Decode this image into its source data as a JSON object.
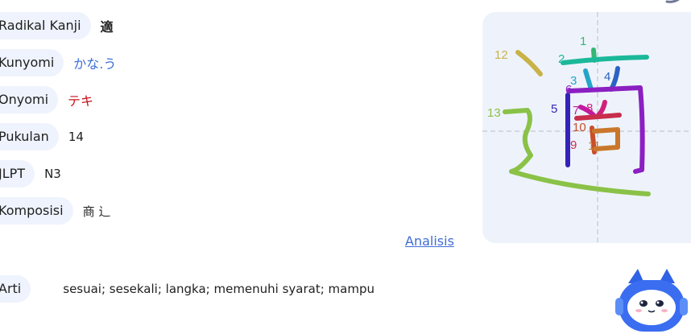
{
  "info_rows": [
    {
      "label": "Radikal Kanji",
      "value": "適",
      "style": "kanji"
    },
    {
      "label": "Kunyomi",
      "value": "かな.う",
      "style": "blue"
    },
    {
      "label": "Onyomi",
      "value": "テキ",
      "style": "red"
    },
    {
      "label": "Pukulan",
      "value": "14",
      "style": "plain"
    },
    {
      "label": "JLPT",
      "value": "N3",
      "style": "plain"
    },
    {
      "label": "Komposisi",
      "value": "商 辶",
      "style": "plain"
    }
  ],
  "analysis_link": "Analisis",
  "meaning": {
    "label": "Arti",
    "value": "sesuai; sesekali; langka; memenuhi syarat; mampu"
  },
  "stroke_numbers": [
    "1",
    "2",
    "3",
    "4",
    "5",
    "6",
    "7",
    "8",
    "9",
    "10",
    "11",
    "12",
    "13"
  ],
  "stroke_colors": {
    "1": "#34b774",
    "2": "#1bb89a",
    "3": "#23a6c9",
    "4": "#2b62c4",
    "5": "#3423b8",
    "6": "#8b1fc2",
    "7": "#c21aa0",
    "8": "#d0207a",
    "9": "#c92d4c",
    "10": "#c94e2b",
    "11": "#c9772c",
    "12": "#c9b248",
    "13": "#8ac248"
  },
  "colors": {
    "pill_bg": "#eef3fd",
    "link": "#3f6cd4",
    "kunyomi": "#3c6fd6",
    "onyomi": "#c4141b",
    "card_bg": "#eef3fb"
  }
}
